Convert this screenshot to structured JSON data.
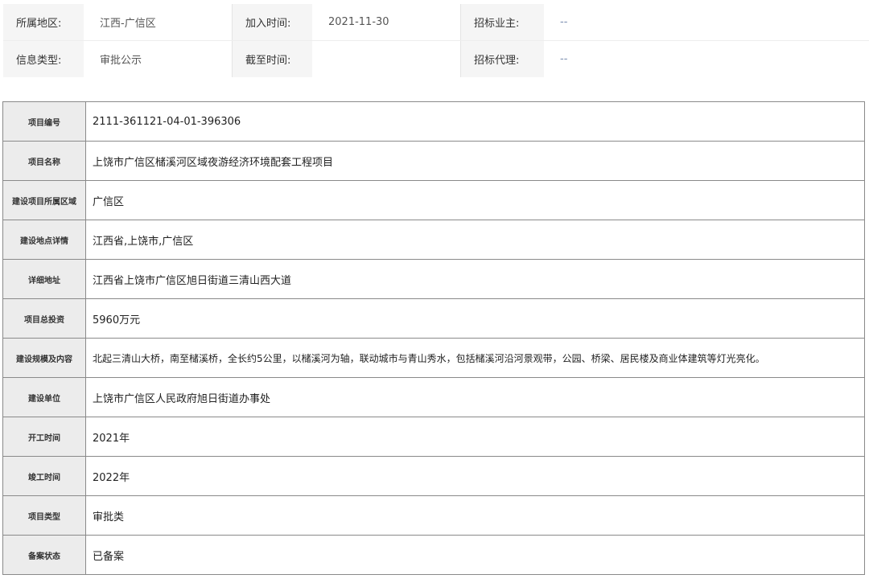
{
  "info": {
    "region_label": "所属地区:",
    "region_value": "江西-广信区",
    "join_time_label": "加入时间:",
    "join_time_value": "2021-11-30",
    "owner_label": "招标业主:",
    "owner_value": "--",
    "type_label": "信息类型:",
    "type_value": "审批公示",
    "deadline_label": "截至时间:",
    "deadline_value": "",
    "agent_label": "招标代理:",
    "agent_value": "--"
  },
  "details": [
    {
      "label": "项目编号",
      "value": "2111-361121-04-01-396306"
    },
    {
      "label": "项目名称",
      "value": "上饶市广信区槠溪河区域夜游经济环境配套工程项目"
    },
    {
      "label": "建设项目所属区域",
      "value": "广信区"
    },
    {
      "label": "建设地点详情",
      "value": "江西省,上饶市,广信区"
    },
    {
      "label": "详细地址",
      "value": "江西省上饶市广信区旭日街道三清山西大道"
    },
    {
      "label": "项目总投资",
      "value": "5960万元"
    },
    {
      "label": "建设规模及内容",
      "value": "北起三清山大桥，南至槠溪桥，全长约5公里，以槠溪河为轴，联动城市与青山秀水，包括槠溪河沿河景观带，公园、桥梁、居民楼及商业体建筑等灯光亮化。"
    },
    {
      "label": "建设单位",
      "value": "上饶市广信区人民政府旭日街道办事处"
    },
    {
      "label": "开工时间",
      "value": "2021年"
    },
    {
      "label": "竣工时间",
      "value": "2022年"
    },
    {
      "label": "项目类型",
      "value": "审批类"
    },
    {
      "label": "备案状态",
      "value": "已备案"
    }
  ]
}
